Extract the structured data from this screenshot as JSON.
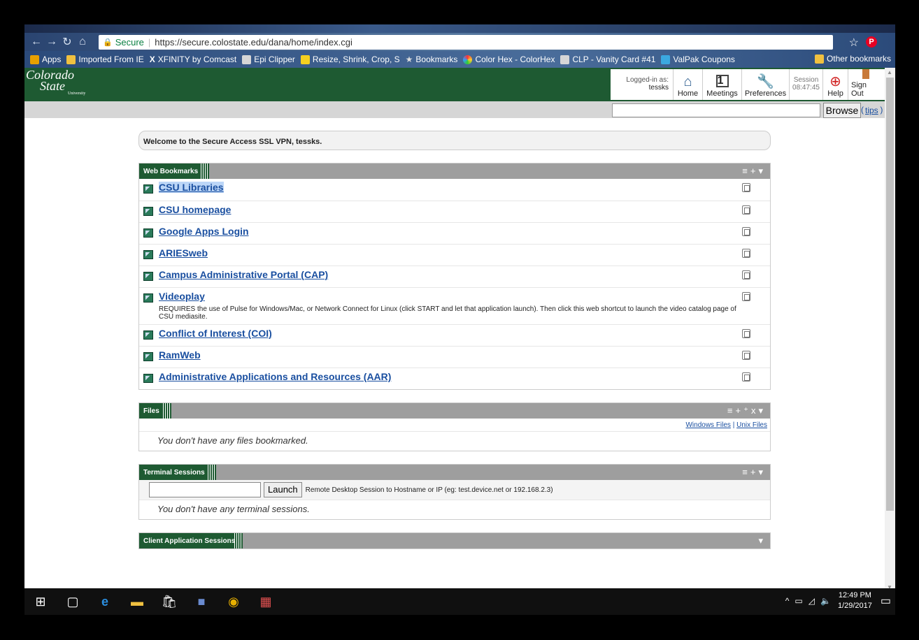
{
  "browser": {
    "address_secure": "Secure",
    "address_url": "https://secure.colostate.edu/dana/home/index.cgi",
    "bookmarks": [
      "Apps",
      "Imported From IE",
      "XFINITY by Comcast",
      "Epi Clipper",
      "Resize, Shrink, Crop, S",
      "Bookmarks",
      "Color Hex - ColorHex",
      "CLP - Vanity Card #41",
      "ValPak Coupons"
    ],
    "other_bookmarks": "Other bookmarks"
  },
  "header": {
    "logo_line1": "Colorado",
    "logo_line2": "State",
    "logo_line3": "University",
    "logged_in_label": "Logged-in as:",
    "logged_in_user": "tessks",
    "home": "Home",
    "meetings": "Meetings",
    "preferences": "Preferences",
    "session_label": "Session",
    "session_time": "08:47:45",
    "help": "Help",
    "sign_out": "Sign Out",
    "browse_button": "Browse",
    "tips": "tips"
  },
  "welcome": "Welcome to the Secure Access SSL VPN, tessks.",
  "web_bookmarks": {
    "title": "Web Bookmarks",
    "items": [
      {
        "label": "CSU Libraries",
        "desc": ""
      },
      {
        "label": "CSU homepage ",
        "desc": ""
      },
      {
        "label": "Google Apps Login ",
        "desc": ""
      },
      {
        "label": "ARIESweb ",
        "desc": ""
      },
      {
        "label": "Campus Administrative Portal (CAP) ",
        "desc": ""
      },
      {
        "label": "Videoplay ",
        "desc": "REQUIRES the use of Pulse for Windows/Mac, or Network Connect for Linux (click START and let that application launch). Then click this web shortcut to launch the video catalog page of CSU mediasite."
      },
      {
        "label": "Conflict of Interest (COI) ",
        "desc": ""
      },
      {
        "label": "RamWeb ",
        "desc": ""
      },
      {
        "label": "Administrative Applications and Resources (AAR) ",
        "desc": ""
      }
    ]
  },
  "files": {
    "title": "Files",
    "windows_files": "Windows Files",
    "unix_files": "Unix Files",
    "separator": " | ",
    "empty": "You don't have any files bookmarked."
  },
  "terminal": {
    "title": "Terminal Sessions",
    "launch": "Launch",
    "label": "Remote Desktop Session to Hostname or IP (eg: test.device.net or 192.168.2.3)",
    "empty": "You don't have any terminal sessions."
  },
  "client_apps": {
    "title": "Client Application Sessions"
  },
  "taskbar": {
    "time": "12:49 PM",
    "date": "1/29/2017"
  }
}
